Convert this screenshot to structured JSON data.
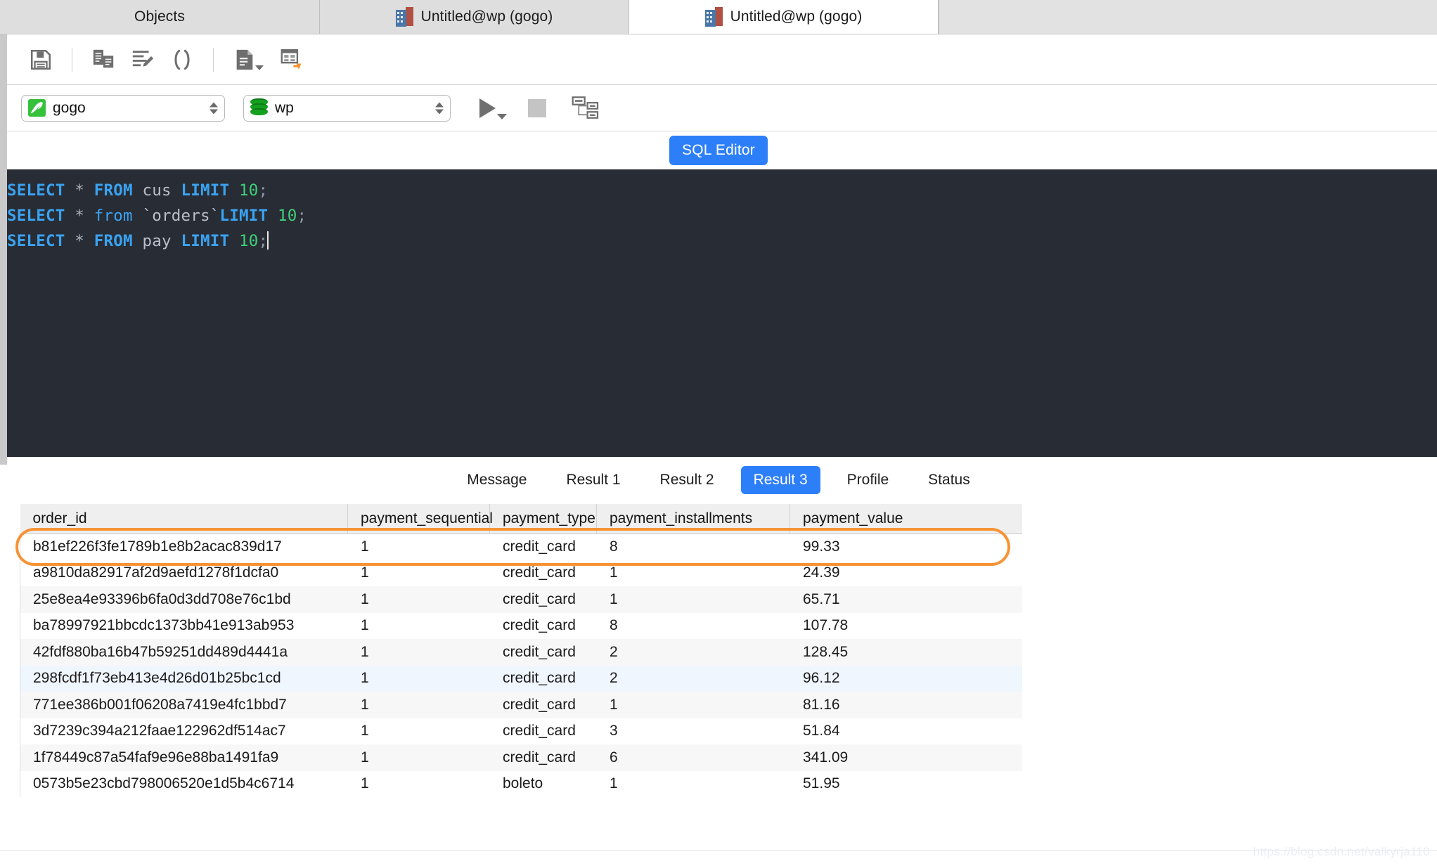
{
  "window": {
    "tabs": [
      {
        "label": "Objects",
        "icon": null,
        "active": false
      },
      {
        "label": "Untitled@wp (gogo)",
        "icon": "database-building-icon",
        "active": false
      },
      {
        "label": "Untitled@wp (gogo)",
        "icon": "database-building-icon",
        "active": true
      }
    ]
  },
  "toolbar": {
    "buttons": [
      {
        "name": "save-icon",
        "title": "Save"
      },
      {
        "name": "copy-query-icon",
        "title": "Copy"
      },
      {
        "name": "beautify-sql-icon",
        "title": "Beautify SQL"
      },
      {
        "name": "parentheses-icon",
        "title": "Code Snippet"
      },
      {
        "name": "export-result-icon",
        "title": "Export Result"
      },
      {
        "name": "data-transfer-icon",
        "title": "Transfer"
      }
    ]
  },
  "connection_bar": {
    "connection": {
      "label": "gogo",
      "icon": "mysql-dolphin-icon"
    },
    "database": {
      "label": "wp",
      "icon": "database-cylinder-icon"
    },
    "run_button": "run-icon",
    "stop_button": "stop-icon",
    "explain_button": "explain-plan-icon"
  },
  "editor": {
    "badge": "SQL Editor",
    "lines": [
      {
        "tokens": [
          {
            "t": "SELECT",
            "c": "kw"
          },
          {
            "t": " ",
            "c": "sp"
          },
          {
            "t": "*",
            "c": "star"
          },
          {
            "t": " ",
            "c": "sp"
          },
          {
            "t": "FROM",
            "c": "kw"
          },
          {
            "t": " ",
            "c": "sp"
          },
          {
            "t": "cus",
            "c": "ident"
          },
          {
            "t": " ",
            "c": "sp"
          },
          {
            "t": "LIMIT",
            "c": "kw"
          },
          {
            "t": " ",
            "c": "sp"
          },
          {
            "t": "10",
            "c": "num"
          },
          {
            "t": ";",
            "c": "punc"
          }
        ]
      },
      {
        "tokens": [
          {
            "t": "SELECT",
            "c": "kw"
          },
          {
            "t": " ",
            "c": "sp"
          },
          {
            "t": "*",
            "c": "star"
          },
          {
            "t": " ",
            "c": "sp"
          },
          {
            "t": "from",
            "c": "kw2"
          },
          {
            "t": " ",
            "c": "sp"
          },
          {
            "t": "`orders`",
            "c": "bq"
          },
          {
            "t": "LIMIT",
            "c": "kw"
          },
          {
            "t": " ",
            "c": "sp"
          },
          {
            "t": "10",
            "c": "num"
          },
          {
            "t": ";",
            "c": "punc"
          }
        ]
      },
      {
        "tokens": [
          {
            "t": "SELECT",
            "c": "kw"
          },
          {
            "t": " ",
            "c": "sp"
          },
          {
            "t": "*",
            "c": "star"
          },
          {
            "t": " ",
            "c": "sp"
          },
          {
            "t": "FROM",
            "c": "kw"
          },
          {
            "t": " ",
            "c": "sp"
          },
          {
            "t": "pay",
            "c": "ident"
          },
          {
            "t": " ",
            "c": "sp"
          },
          {
            "t": "LIMIT",
            "c": "kw"
          },
          {
            "t": " ",
            "c": "sp"
          },
          {
            "t": "10",
            "c": "num"
          },
          {
            "t": ";",
            "c": "punc"
          }
        ]
      }
    ],
    "plain_text": [
      "SELECT * FROM cus LIMIT 10;",
      "SELECT * from `orders`LIMIT 10;",
      "SELECT * FROM pay LIMIT 10;"
    ]
  },
  "result_tabs": [
    {
      "label": "Message",
      "selected": false
    },
    {
      "label": "Result 1",
      "selected": false
    },
    {
      "label": "Result 2",
      "selected": false
    },
    {
      "label": "Result 3",
      "selected": true
    },
    {
      "label": "Profile",
      "selected": false
    },
    {
      "label": "Status",
      "selected": false
    }
  ],
  "result_grid": {
    "columns": [
      "order_id",
      "payment_sequential",
      "payment_type",
      "payment_installments",
      "payment_value"
    ],
    "rows": [
      [
        "b81ef226f3fe1789b1e8b2acac839d17",
        "1",
        "credit_card",
        "8",
        "99.33"
      ],
      [
        "a9810da82917af2d9aefd1278f1dcfa0",
        "1",
        "credit_card",
        "1",
        "24.39"
      ],
      [
        "25e8ea4e93396b6fa0d3dd708e76c1bd",
        "1",
        "credit_card",
        "1",
        "65.71"
      ],
      [
        "ba78997921bbcdc1373bb41e913ab953",
        "1",
        "credit_card",
        "8",
        "107.78"
      ],
      [
        "42fdf880ba16b47b59251dd489d4441a",
        "1",
        "credit_card",
        "2",
        "128.45"
      ],
      [
        "298fcdf1f73eb413e4d26d01b25bc1cd",
        "1",
        "credit_card",
        "2",
        "96.12"
      ],
      [
        "771ee386b001f06208a7419e4fc1bbd7",
        "1",
        "credit_card",
        "1",
        "81.16"
      ],
      [
        "3d7239c394a212faae122962df514ac7",
        "1",
        "credit_card",
        "3",
        "51.84"
      ],
      [
        "1f78449c87a54faf9e96e88ba1491fa9",
        "1",
        "credit_card",
        "6",
        "341.09"
      ],
      [
        "0573b5e23cbd798006520e1d5b4c6714",
        "1",
        "boleto",
        "1",
        "51.95"
      ]
    ]
  },
  "annotation": {
    "header_highlight_color": "#f79334"
  },
  "watermark": "https://blog.csdn.net/valkyrja110",
  "colors": {
    "accent_blue": "#2d7ff9",
    "editor_bg": "#282c34",
    "keyword": "#3aa3f2",
    "number": "#3fd07a",
    "highlight_orange": "#f79334"
  }
}
